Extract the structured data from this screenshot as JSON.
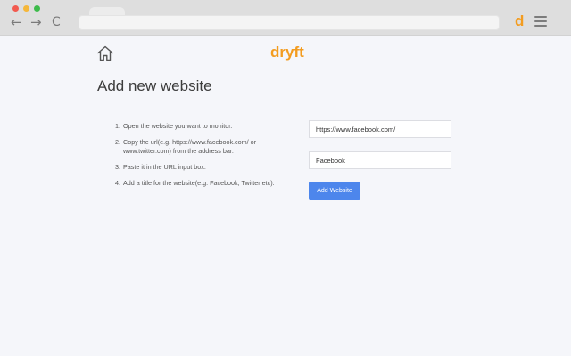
{
  "browser": {
    "nav_back": "←",
    "nav_forward": "→",
    "nav_reload": "C",
    "extension_letter": "d"
  },
  "header": {
    "brand": "dryft"
  },
  "page": {
    "title": "Add new website"
  },
  "instructions": {
    "items": [
      "Open the website you want to monitor.",
      "Copy the url(e.g. https://www.facebook.com/ or www.twitter.com) from the address bar.",
      "Paste it in the URL input box.",
      "Add a title for the website(e.g. Facebook, Twitter etc)."
    ]
  },
  "form": {
    "url_value": "https://www.facebook.com/",
    "title_value": "Facebook",
    "submit_label": "Add Website"
  },
  "colors": {
    "brand": "#f39c1f",
    "button": "#4d86ec",
    "background": "#f5f6fa"
  }
}
